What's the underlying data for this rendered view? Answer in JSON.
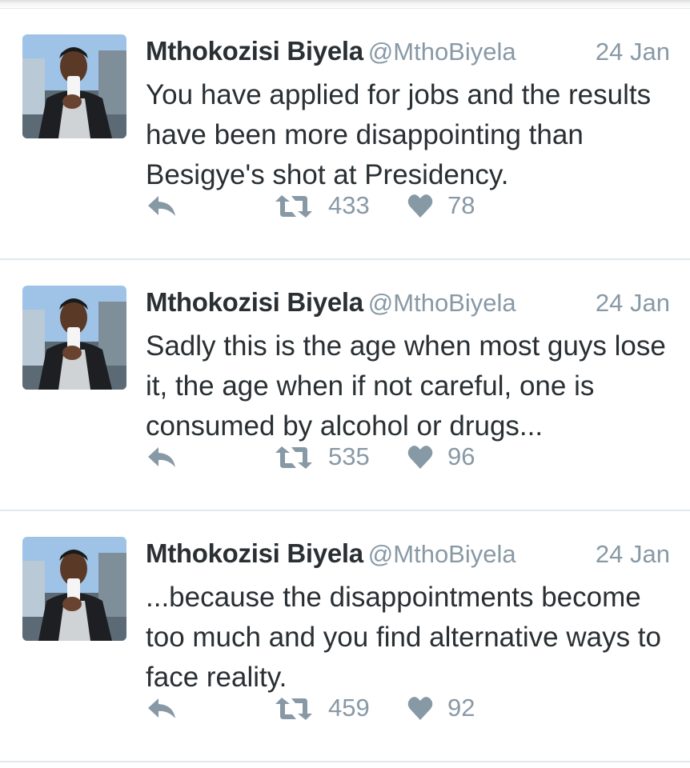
{
  "colors": {
    "text": "#292f33",
    "secondary": "#8899a6",
    "divider": "#e1e8ed"
  },
  "tweets": [
    {
      "author_name": "Mthokozisi Biyela",
      "handle": "@MthoBiyela",
      "time": "24 Jan",
      "text": "You have applied for jobs and the results have been more disappointing than Besigye's shot at Presidency.",
      "retweets": "433",
      "likes": "78",
      "icons": [
        "avatar",
        "reply-icon",
        "retweet-icon",
        "heart-icon"
      ]
    },
    {
      "author_name": "Mthokozisi Biyela",
      "handle": "@MthoBiyela",
      "time": "24 Jan",
      "text": "Sadly this is the age when most guys lose it, the age when if not careful, one is consumed by alcohol or drugs...",
      "retweets": "535",
      "likes": "96",
      "icons": [
        "avatar",
        "reply-icon",
        "retweet-icon",
        "heart-icon"
      ]
    },
    {
      "author_name": "Mthokozisi Biyela",
      "handle": "@MthoBiyela",
      "time": "24 Jan",
      "text": "...because the disappointments become too much and you find alternative ways to face reality.",
      "retweets": "459",
      "likes": "92",
      "icons": [
        "avatar",
        "reply-icon",
        "retweet-icon",
        "heart-icon"
      ]
    }
  ]
}
